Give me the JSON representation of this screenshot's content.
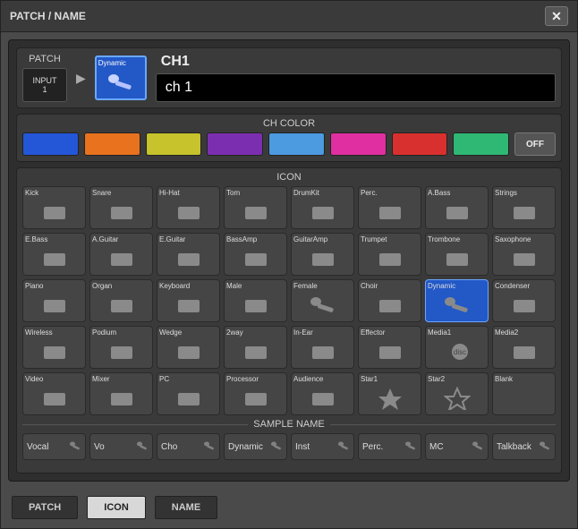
{
  "window": {
    "title": "PATCH / NAME"
  },
  "patch": {
    "label": "PATCH",
    "input_label": "INPUT",
    "input_number": "1",
    "preview_icon_label": "Dynamic",
    "channel_label": "CH1",
    "channel_name": "ch 1"
  },
  "ch_color": {
    "title": "CH COLOR",
    "off_label": "OFF",
    "colors": [
      "#2456d8",
      "#e8721e",
      "#c6c32c",
      "#7b2fb0",
      "#4c9ae0",
      "#e02fa0",
      "#d8302e",
      "#2fb874"
    ]
  },
  "icon_section": {
    "title": "ICON",
    "selected": 20,
    "items": [
      "Kick",
      "Snare",
      "Hi-Hat",
      "Tom",
      "DrumKit",
      "Perc.",
      "A.Bass",
      "Strings",
      "E.Bass",
      "A.Guitar",
      "E.Guitar",
      "BassAmp",
      "GuitarAmp",
      "Trumpet",
      "Trombone",
      "Saxophone",
      "Piano",
      "Organ",
      "Keyboard",
      "Male",
      "Female",
      "Choir",
      "Dynamic",
      "Condenser",
      "Wireless",
      "Podium",
      "Wedge",
      "2way",
      "In-Ear",
      "Effector",
      "Media1",
      "Media2",
      "Video",
      "Mixer",
      "PC",
      "Processor",
      "Audience",
      "Star1",
      "Star2",
      "Blank"
    ]
  },
  "sample_name": {
    "title": "SAMPLE NAME",
    "items": [
      "Vocal",
      "Vo",
      "Cho",
      "Dynamic",
      "Inst",
      "Perc.",
      "MC",
      "Talkback"
    ]
  },
  "tabs": {
    "items": [
      "PATCH",
      "ICON",
      "NAME"
    ],
    "active": 1
  }
}
